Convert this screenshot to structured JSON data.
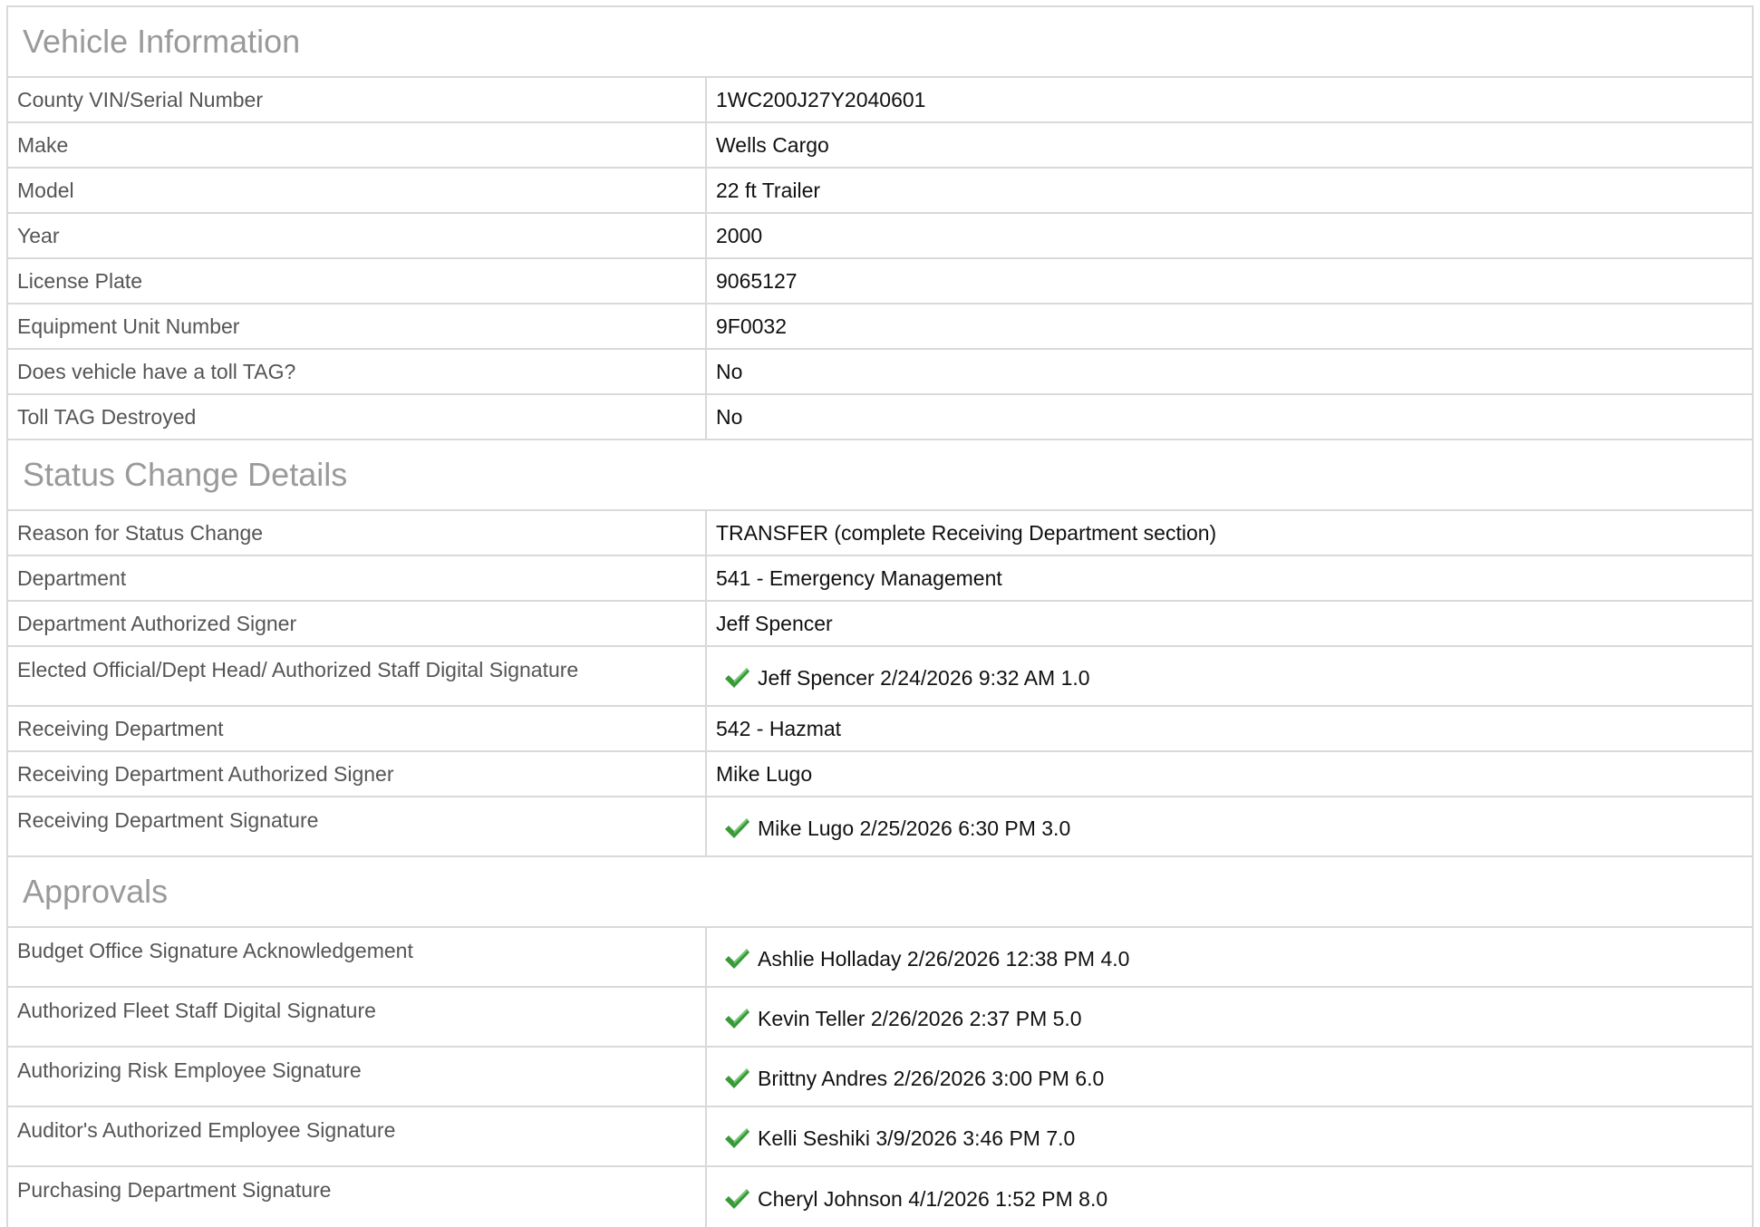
{
  "sections": [
    {
      "title": "Vehicle Information",
      "rows": [
        {
          "label": "County VIN/Serial Number",
          "value": "1WC200J27Y2040601"
        },
        {
          "label": "Make",
          "value": "Wells Cargo"
        },
        {
          "label": "Model",
          "value": "22 ft Trailer"
        },
        {
          "label": "Year",
          "value": "2000"
        },
        {
          "label": "License Plate",
          "value": "9065127"
        },
        {
          "label": "Equipment Unit Number",
          "value": "9F0032"
        },
        {
          "label": "Does vehicle have a toll TAG?",
          "value": "No"
        },
        {
          "label": "Toll TAG Destroyed",
          "value": "No"
        }
      ]
    },
    {
      "title": "Status Change Details",
      "rows": [
        {
          "label": "Reason for Status Change",
          "value": "TRANSFER (complete Receiving Department section)"
        },
        {
          "label": "Department",
          "value": "541 - Emergency Management"
        },
        {
          "label": "Department Authorized Signer",
          "value": "Jeff Spencer"
        },
        {
          "label": "Elected Official/Dept Head/ Authorized Staff Digital Signature",
          "value": "Jeff Spencer 2/24/2026 9:32 AM 1.0",
          "signature": true
        },
        {
          "label": "Receiving Department",
          "value": "542 - Hazmat"
        },
        {
          "label": "Receiving Department Authorized Signer",
          "value": "Mike Lugo"
        },
        {
          "label": "Receiving Department Signature",
          "value": "Mike Lugo 2/25/2026 6:30 PM 3.0",
          "signature": true
        }
      ]
    },
    {
      "title": "Approvals",
      "rows": [
        {
          "label": "Budget Office Signature Acknowledgement",
          "value": "Ashlie Holladay 2/26/2026 12:38 PM 4.0",
          "signature": true
        },
        {
          "label": "Authorized Fleet Staff Digital Signature",
          "value": "Kevin Teller 2/26/2026 2:37 PM 5.0",
          "signature": true
        },
        {
          "label": "Authorizing Risk Employee Signature",
          "value": "Brittny Andres 2/26/2026 3:00 PM 6.0",
          "signature": true
        },
        {
          "label": "Auditor's Authorized Employee Signature",
          "value": "Kelli Seshiki 3/9/2026 3:46 PM 7.0",
          "signature": true
        },
        {
          "label": "Purchasing Department Signature",
          "value": "Cheryl Johnson 4/1/2026 1:52 PM 8.0",
          "signature": true
        }
      ]
    }
  ],
  "icons": {
    "signature_check": "check-icon"
  },
  "colors": {
    "check": "#3a9a3a",
    "header_text": "#9a9a9a",
    "border": "#d9d9d9"
  }
}
